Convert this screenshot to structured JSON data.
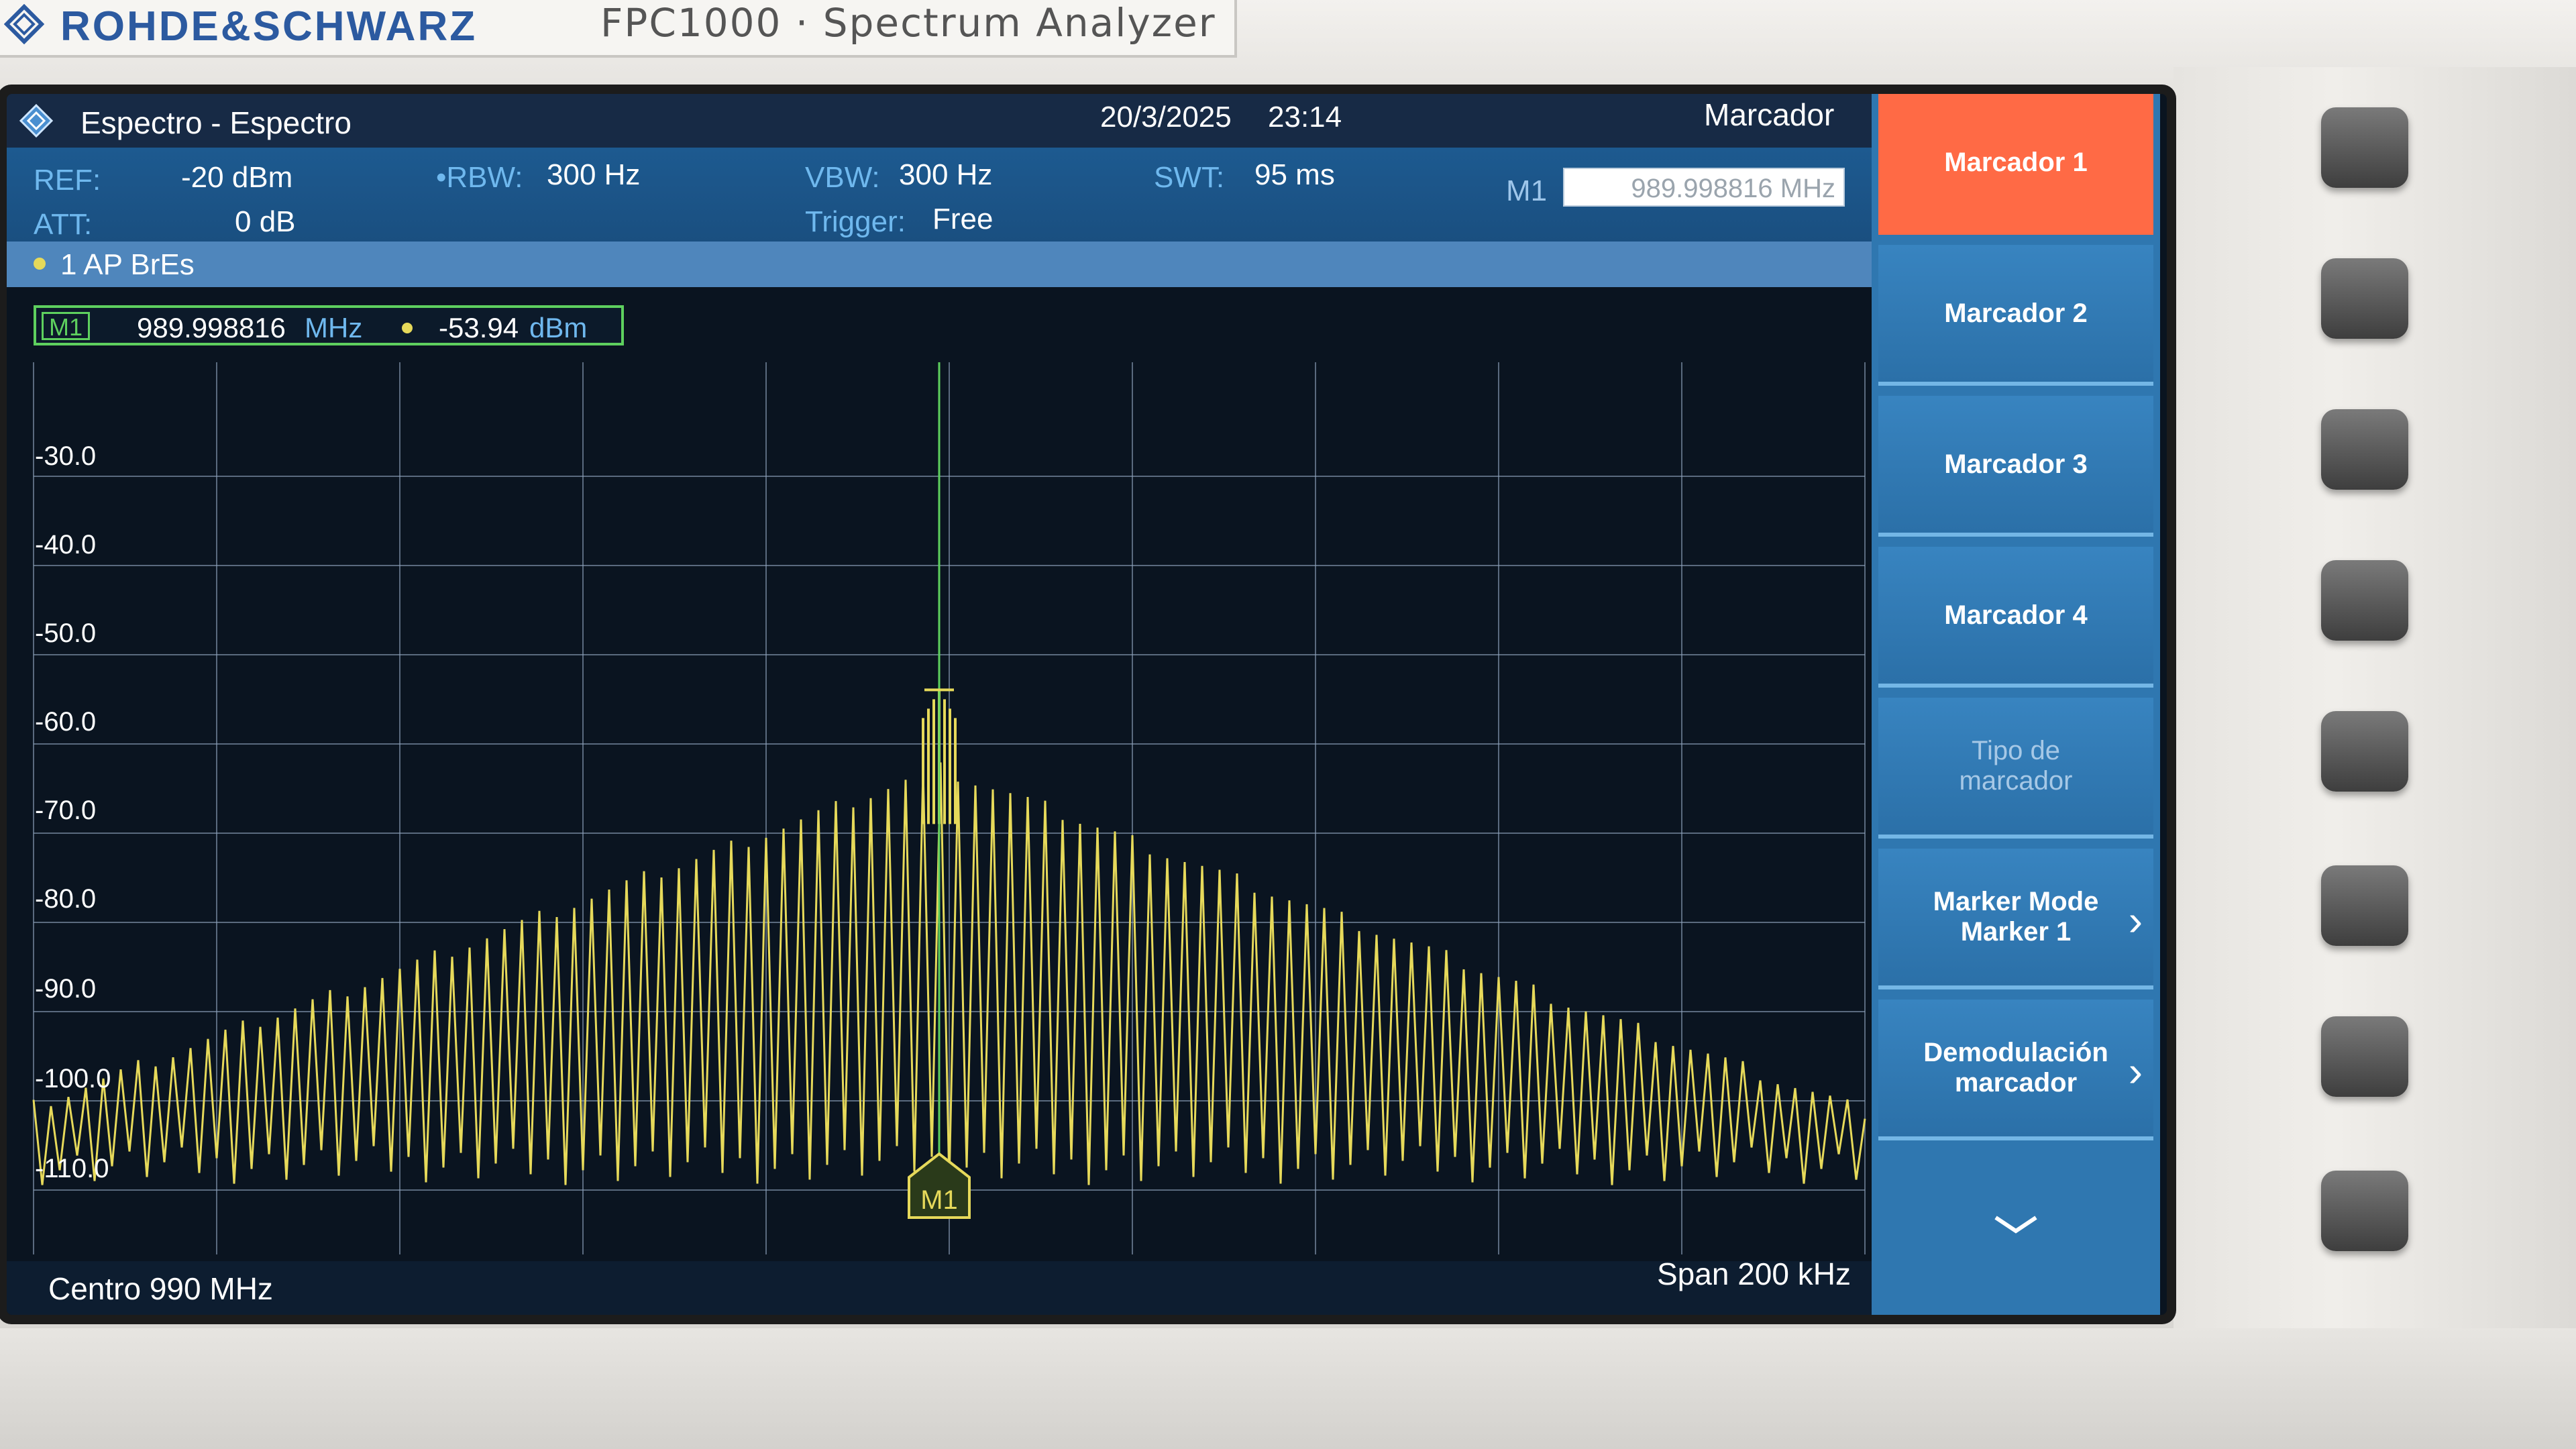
{
  "brand": {
    "name": "ROHDE&SCHWARZ",
    "model": "FPC1000 · Spectrum Analyzer"
  },
  "titlebar": {
    "app_title": "Espectro - Espectro",
    "date": "20/3/2025",
    "time": "23:14",
    "menu_title": "Marcador"
  },
  "settings": {
    "ref_label": "REF:",
    "ref_value": "-20 dBm",
    "att_label": "ATT:",
    "att_value": "0 dB",
    "rbw_label": "•RBW:",
    "rbw_value": "300 Hz",
    "vbw_label": "VBW:",
    "vbw_value": "300 Hz",
    "trigger_label": "Trigger:",
    "trigger_value": "Free",
    "swt_label": "SWT:",
    "swt_value": "95 ms",
    "m1_label": "M1",
    "m1_input_value": "989.998816 MHz"
  },
  "trace": {
    "name": "1 AP BrEs",
    "color": "#e6d95a"
  },
  "marker_readout": {
    "tag": "M1",
    "freq": "989.998816",
    "freq_unit": "MHz",
    "level": "-53.94",
    "level_unit": "dBm"
  },
  "plot": {
    "y_ticks": [
      "-30.0",
      "-40.0",
      "-50.0",
      "-60.0",
      "-70.0",
      "-80.0",
      "-90.0",
      "-100.0",
      "-110.0"
    ],
    "marker_label": "M1"
  },
  "footer": {
    "center": "Centro 990 MHz",
    "span": "Span 200 kHz"
  },
  "softkeys": [
    {
      "label": "Marcador 1",
      "state": "active"
    },
    {
      "label": "Marcador 2",
      "state": "normal"
    },
    {
      "label": "Marcador 3",
      "state": "normal"
    },
    {
      "label": "Marcador 4",
      "state": "normal"
    },
    {
      "label": "Tipo de marcador",
      "state": "dim"
    },
    {
      "label": "Marker Mode Marker 1",
      "state": "submenu"
    },
    {
      "label": "Demodulación marcador",
      "state": "submenu"
    }
  ],
  "chart_data": {
    "type": "line",
    "xlabel": "Centro 990 MHz",
    "ylabel": "",
    "x_center_mhz": 990,
    "x_span_khz": 200,
    "ylim": [
      -115,
      -20
    ],
    "marker": {
      "name": "M1",
      "x_mhz": 989.998816,
      "y_dbm": -53.94
    },
    "series": [
      {
        "values_description_free": null,
        "peak_dbm": -53.94
      }
    ]
  },
  "colors": {
    "trace": "#e6d95a",
    "marker": "#5ed05e",
    "softkey_active": "#ff6a45",
    "softkey": "#2f77b0"
  }
}
